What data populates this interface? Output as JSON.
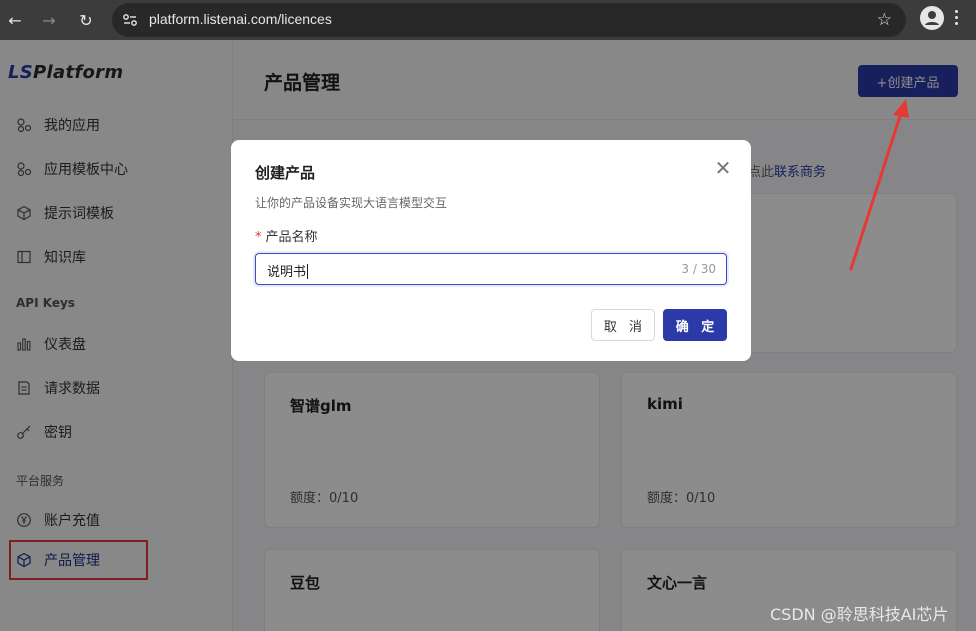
{
  "browser": {
    "url": "platform.listenai.com/licences"
  },
  "sidebar": {
    "logo_prefix": "LS",
    "logo_rest": "Platform",
    "items": [
      {
        "label": "我的应用",
        "icon": "apps-icon"
      },
      {
        "label": "应用模板中心",
        "icon": "template-icon"
      },
      {
        "label": "提示词模板",
        "icon": "cube-icon"
      },
      {
        "label": "知识库",
        "icon": "book-icon"
      }
    ],
    "section_api": "API Keys",
    "api_items": [
      {
        "label": "仪表盘",
        "icon": "bar-chart-icon"
      },
      {
        "label": "请求数据",
        "icon": "document-icon"
      },
      {
        "label": "密钥",
        "icon": "key-icon"
      }
    ],
    "section_platform": "平台服务",
    "platform_items": [
      {
        "label": "账户充值",
        "icon": "yen-icon"
      },
      {
        "label": "产品管理",
        "icon": "cube-icon"
      }
    ]
  },
  "header": {
    "title": "产品管理",
    "create_button": "+创建产品"
  },
  "notice": {
    "suffix": "点此",
    "link": "联系商务"
  },
  "cards": [
    {
      "title": "智谱glm",
      "quota_label": "额度：",
      "quota_value": "0/10"
    },
    {
      "title": "kimi",
      "quota_label": "额度：",
      "quota_value": "0/10"
    },
    {
      "title": "豆包"
    },
    {
      "title": "文心一言"
    }
  ],
  "modal": {
    "title": "创建产品",
    "subtitle": "让你的产品设备实现大语言模型交互",
    "required_mark": "*",
    "field_label": "产品名称",
    "input_value": "说明书",
    "counter": "3 / 30",
    "cancel": "取 消",
    "confirm": "确 定"
  },
  "watermark": "CSDN @聆思科技AI芯片",
  "colors": {
    "accent": "#2b3aa8",
    "annotation": "#e53935"
  }
}
